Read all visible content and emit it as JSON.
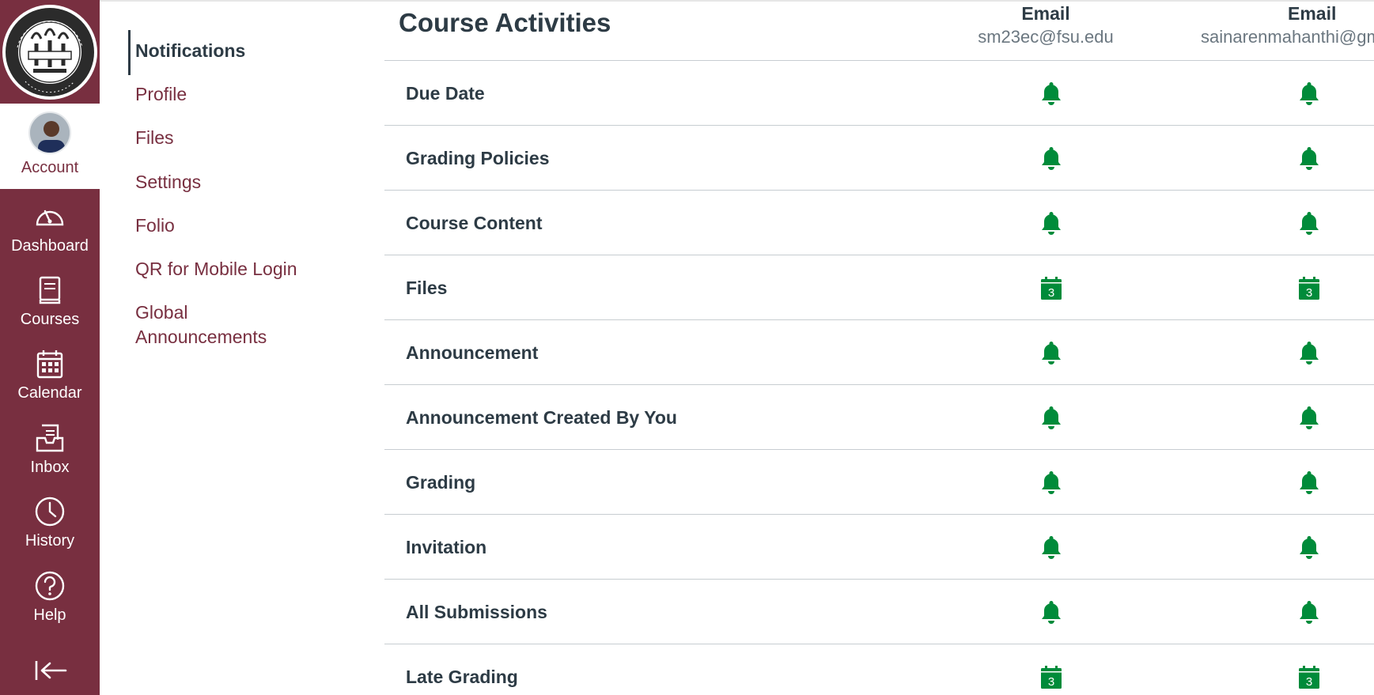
{
  "colors": {
    "brand": "#782f40",
    "text": "#2d3b45",
    "notify_green": "#008b3a"
  },
  "global_nav": {
    "logo_icon": "fsu-seal-logo",
    "account": {
      "label": "Account"
    },
    "items": [
      {
        "label": "Dashboard",
        "icon": "dashboard-icon"
      },
      {
        "label": "Courses",
        "icon": "courses-icon"
      },
      {
        "label": "Calendar",
        "icon": "calendar-icon"
      },
      {
        "label": "Inbox",
        "icon": "inbox-icon"
      },
      {
        "label": "History",
        "icon": "history-icon"
      },
      {
        "label": "Help",
        "icon": "help-icon"
      }
    ],
    "collapse_icon": "collapse-arrow-icon"
  },
  "sub_nav": {
    "items": [
      {
        "label": "Notifications",
        "active": true
      },
      {
        "label": "Profile"
      },
      {
        "label": "Files"
      },
      {
        "label": "Settings"
      },
      {
        "label": "Folio"
      },
      {
        "label": "QR for Mobile Login"
      },
      {
        "label": "Global Announcements"
      }
    ]
  },
  "main": {
    "title": "Course Activities",
    "columns": [
      {
        "type": "Email",
        "address": "sm23ec@fsu.edu"
      },
      {
        "type": "Email",
        "address": "sainarenmahanthi@gm"
      }
    ],
    "rows": [
      {
        "label": "Due Date",
        "setting": [
          "bell",
          "bell"
        ]
      },
      {
        "label": "Grading Policies",
        "setting": [
          "bell",
          "bell"
        ]
      },
      {
        "label": "Course Content",
        "setting": [
          "bell",
          "bell"
        ]
      },
      {
        "label": "Files",
        "setting": [
          "calendar-daily",
          "calendar-daily"
        ]
      },
      {
        "label": "Announcement",
        "setting": [
          "bell",
          "bell"
        ]
      },
      {
        "label": "Announcement Created By You",
        "setting": [
          "bell",
          "bell"
        ]
      },
      {
        "label": "Grading",
        "setting": [
          "bell",
          "bell"
        ]
      },
      {
        "label": "Invitation",
        "setting": [
          "bell",
          "bell"
        ]
      },
      {
        "label": "All Submissions",
        "setting": [
          "bell",
          "bell"
        ]
      },
      {
        "label": "Late Grading",
        "setting": [
          "calendar-daily",
          "calendar-daily"
        ]
      }
    ]
  }
}
